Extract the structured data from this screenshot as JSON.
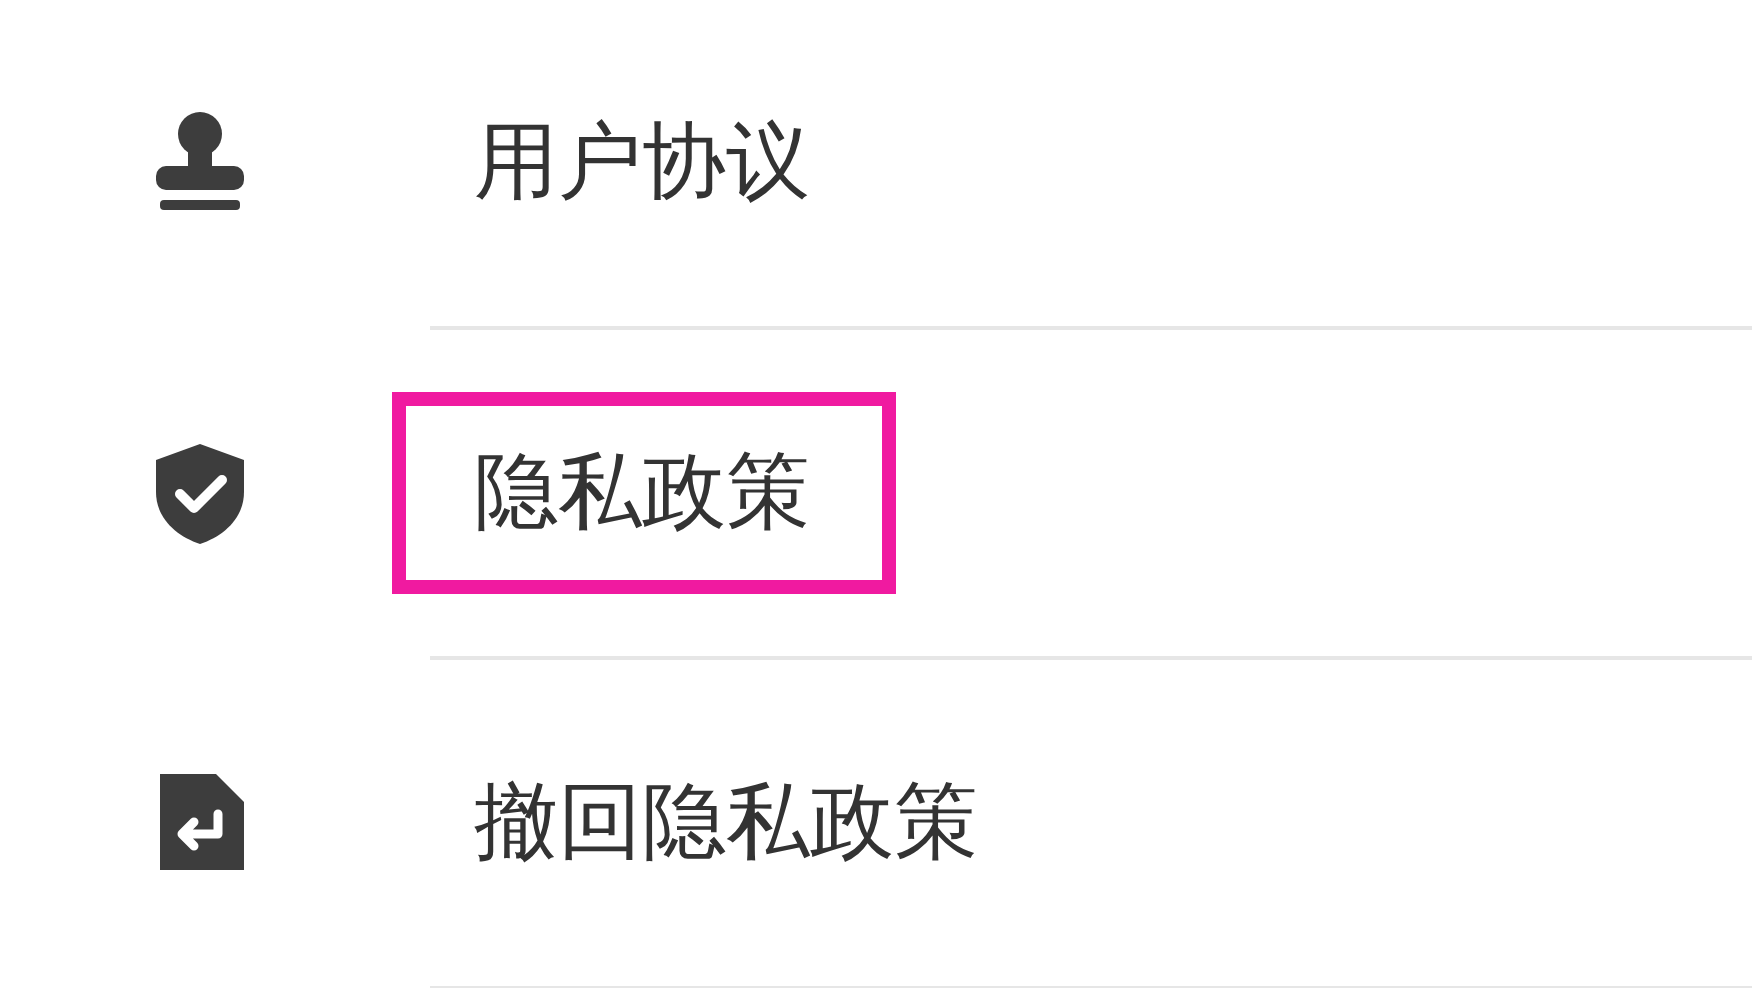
{
  "menu_items": [
    {
      "kind": "stamp",
      "label": "用户协议",
      "highlighted": false
    },
    {
      "kind": "shield",
      "label": "隐私政策",
      "highlighted": true
    },
    {
      "kind": "revoke",
      "label": "撤回隐私政策",
      "highlighted": false
    }
  ]
}
